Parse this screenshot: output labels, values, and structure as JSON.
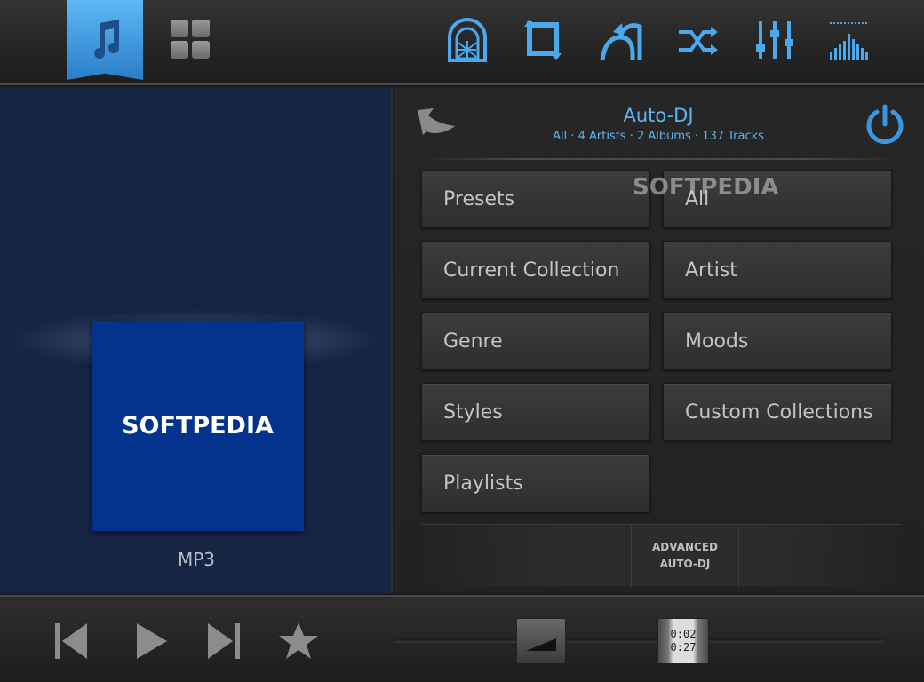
{
  "header": {
    "active_tab_icon": "music-note-icon",
    "icons": [
      "jukebox-icon",
      "repeat-icon",
      "undo-icon",
      "shuffle-icon",
      "equalizer-icon",
      "spectrum-icon"
    ],
    "accent_color": "#5cb6f0"
  },
  "now_playing": {
    "cover_text": "SOFTPEDIA",
    "format": "MP3"
  },
  "autodj": {
    "title": "Auto-DJ",
    "subtitle": "All · 4 Artists · 2 Albums · 137 Tracks",
    "watermark": "SOFTPEDIA",
    "options": [
      "Presets",
      "All",
      "Current Collection",
      "Artist",
      "Genre",
      "Moods",
      "Styles",
      "Custom Collections",
      "Playlists"
    ],
    "advanced_line1": "ADVANCED",
    "advanced_line2": "AUTO-DJ"
  },
  "transport": {
    "elapsed": "0:02",
    "total": "0:27"
  }
}
